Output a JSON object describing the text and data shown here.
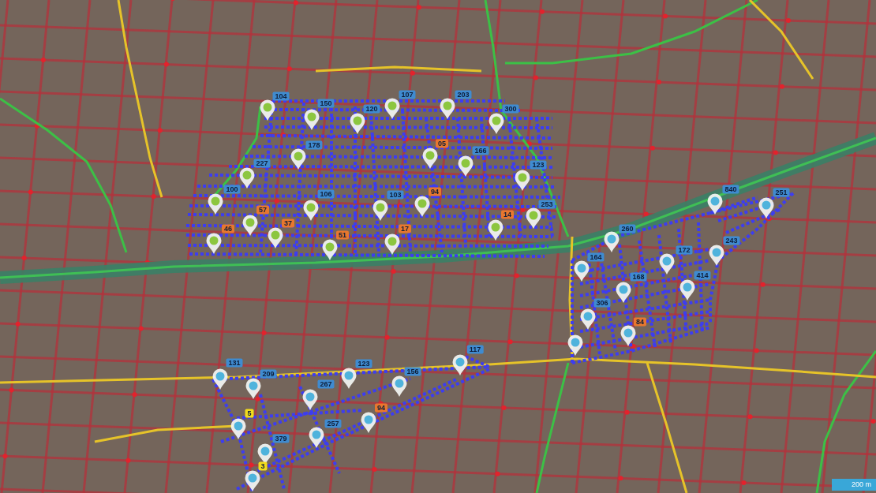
{
  "map": {
    "pins": [
      {
        "color": "#8cc63f"
      },
      {
        "color": "#8cc63f"
      },
      {
        "color": "#8cc63f"
      },
      {
        "color": "#8cc63f"
      },
      {
        "color": "#8cc63f"
      },
      {
        "color": "#8cc63f"
      },
      {
        "color": "#8cc63f"
      },
      {
        "color": "#8cc63f"
      },
      {
        "color": "#8cc63f"
      },
      {
        "color": "#8cc63f"
      },
      {
        "color": "#8cc63f"
      },
      {
        "color": "#8cc63f"
      },
      {
        "color": "#8cc63f"
      },
      {
        "color": "#8cc63f"
      },
      {
        "color": "#8cc63f"
      },
      {
        "color": "#8cc63f"
      },
      {
        "color": "#8cc63f"
      },
      {
        "color": "#8cc63f"
      },
      {
        "color": "#8cc63f"
      },
      {
        "color": "#8cc63f"
      },
      {
        "color": "#8cc63f"
      },
      {
        "color": "#8cc63f"
      },
      {
        "color": "#4fb3dc"
      },
      {
        "color": "#4fb3dc"
      },
      {
        "color": "#4fb3dc"
      },
      {
        "color": "#4fb3dc"
      },
      {
        "color": "#4fb3dc"
      },
      {
        "color": "#4fb3dc"
      },
      {
        "color": "#4fb3dc"
      },
      {
        "color": "#4fb3dc"
      },
      {
        "color": "#4fb3dc"
      },
      {
        "color": "#4fb3dc"
      },
      {
        "color": "#4fb3dc"
      },
      {
        "color": "#4fb3dc"
      },
      {
        "color": "#4fb3dc"
      },
      {
        "color": "#4fb3dc"
      },
      {
        "color": "#4fb3dc"
      },
      {
        "color": "#4fb3dc"
      },
      {
        "color": "#4fb3dc"
      },
      {
        "color": "#4fb3dc"
      },
      {
        "color": "#4fb3dc"
      },
      {
        "color": "#4fb3dc"
      },
      {
        "color": "#4fb3dc"
      },
      {
        "color": "#4fb3dc"
      }
    ],
    "labels": [
      {
        "text": "104",
        "color": "#3f8bd0"
      },
      {
        "text": "150",
        "color": "#3f8bd0"
      },
      {
        "text": "120",
        "color": "#3f8bd0"
      },
      {
        "text": "107",
        "color": "#3f8bd0"
      },
      {
        "text": "203",
        "color": "#3f8bd0"
      },
      {
        "text": "300",
        "color": "#3f8bd0"
      },
      {
        "text": "178",
        "color": "#3f8bd0"
      },
      {
        "text": "05",
        "color": "#e8772e"
      },
      {
        "text": "166",
        "color": "#3f8bd0"
      },
      {
        "text": "227",
        "color": "#3f8bd0"
      },
      {
        "text": "123",
        "color": "#3f8bd0"
      },
      {
        "text": "100",
        "color": "#3f8bd0"
      },
      {
        "text": "106",
        "color": "#3f8bd0"
      },
      {
        "text": "103",
        "color": "#3f8bd0"
      },
      {
        "text": "94",
        "color": "#e8772e"
      },
      {
        "text": "840",
        "color": "#3f8bd0"
      },
      {
        "text": "251",
        "color": "#3f8bd0"
      },
      {
        "text": "57",
        "color": "#e8772e"
      },
      {
        "text": "46",
        "color": "#e8772e"
      },
      {
        "text": "37",
        "color": "#e8772e"
      },
      {
        "text": "14",
        "color": "#e8772e"
      },
      {
        "text": "253",
        "color": "#3f8bd0"
      },
      {
        "text": "51",
        "color": "#e8772e"
      },
      {
        "text": "17",
        "color": "#e8772e"
      },
      {
        "text": "260",
        "color": "#3f8bd0"
      },
      {
        "text": "164",
        "color": "#3f8bd0"
      },
      {
        "text": "172",
        "color": "#3f8bd0"
      },
      {
        "text": "243",
        "color": "#3f8bd0"
      },
      {
        "text": "168",
        "color": "#3f8bd0"
      },
      {
        "text": "414",
        "color": "#3f8bd0"
      },
      {
        "text": "306",
        "color": "#3f8bd0"
      },
      {
        "text": "84",
        "color": "#e8772e"
      },
      {
        "text": "117",
        "color": "#3f8bd0"
      },
      {
        "text": "131",
        "color": "#3f8bd0"
      },
      {
        "text": "123",
        "color": "#3f8bd0"
      },
      {
        "text": "209",
        "color": "#3f8bd0"
      },
      {
        "text": "156",
        "color": "#3f8bd0"
      },
      {
        "text": "267",
        "color": "#3f8bd0"
      },
      {
        "text": "5",
        "color": "#f2dc1c"
      },
      {
        "text": "94",
        "color": "#e8772e"
      },
      {
        "text": "257",
        "color": "#3f8bd0"
      },
      {
        "text": "379",
        "color": "#3f8bd0"
      },
      {
        "text": "3",
        "color": "#f2dc1c"
      }
    ],
    "scale_bar": {
      "label": "200 m"
    }
  }
}
